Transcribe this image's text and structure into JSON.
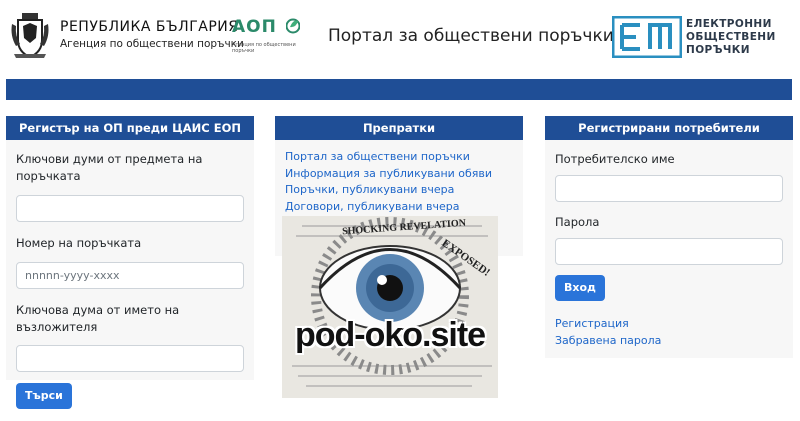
{
  "header": {
    "gov_title": "РЕПУБЛИКА БЪЛГАРИЯ",
    "gov_subtitle": "Агенция по обществени поръчки",
    "aop_word": "АОП",
    "aop_subtitle": "Агенция по обществени поръчки",
    "portal_title": "Портал за обществени поръчки",
    "eop_line1": "ЕЛЕКТРОННИ",
    "eop_line2": "ОБЩЕСТВЕНИ",
    "eop_line3": "ПОРЪЧКИ"
  },
  "register": {
    "title": "Регистър на ОП преди ЦАИС ЕОП",
    "keywords_label": "Ключови думи от предмета на поръчката",
    "keywords_value": "",
    "number_label": "Номер на поръчката",
    "number_placeholder": "nnnnn-yyyy-xxxx",
    "contractor_label": "Ключова дума от името на възложителя",
    "contractor_value": "",
    "search_button": "Търси"
  },
  "links": {
    "title": "Препратки",
    "items": [
      "Портал за обществени поръчки",
      "Информация за публикувани обяви",
      "Поръчки, публикувани вчера",
      "Договори, публикувани вчера"
    ]
  },
  "ad": {
    "site_text": "pod-oko.site",
    "headline_top": "SHOCKING REVELATION",
    "headline_side": "EXPOSED!"
  },
  "login": {
    "title": "Регистрирани потребители",
    "username_label": "Потребителско име",
    "username_value": "",
    "password_label": "Парола",
    "password_value": "",
    "login_button": "Вход",
    "register_link": "Регистрация",
    "forgot_link": "Забравена парола"
  },
  "colors": {
    "primary_blue": "#1f4e96",
    "button_blue": "#2a74d9",
    "link_blue": "#1e66c9",
    "aop_green": "#2b8a6a"
  }
}
